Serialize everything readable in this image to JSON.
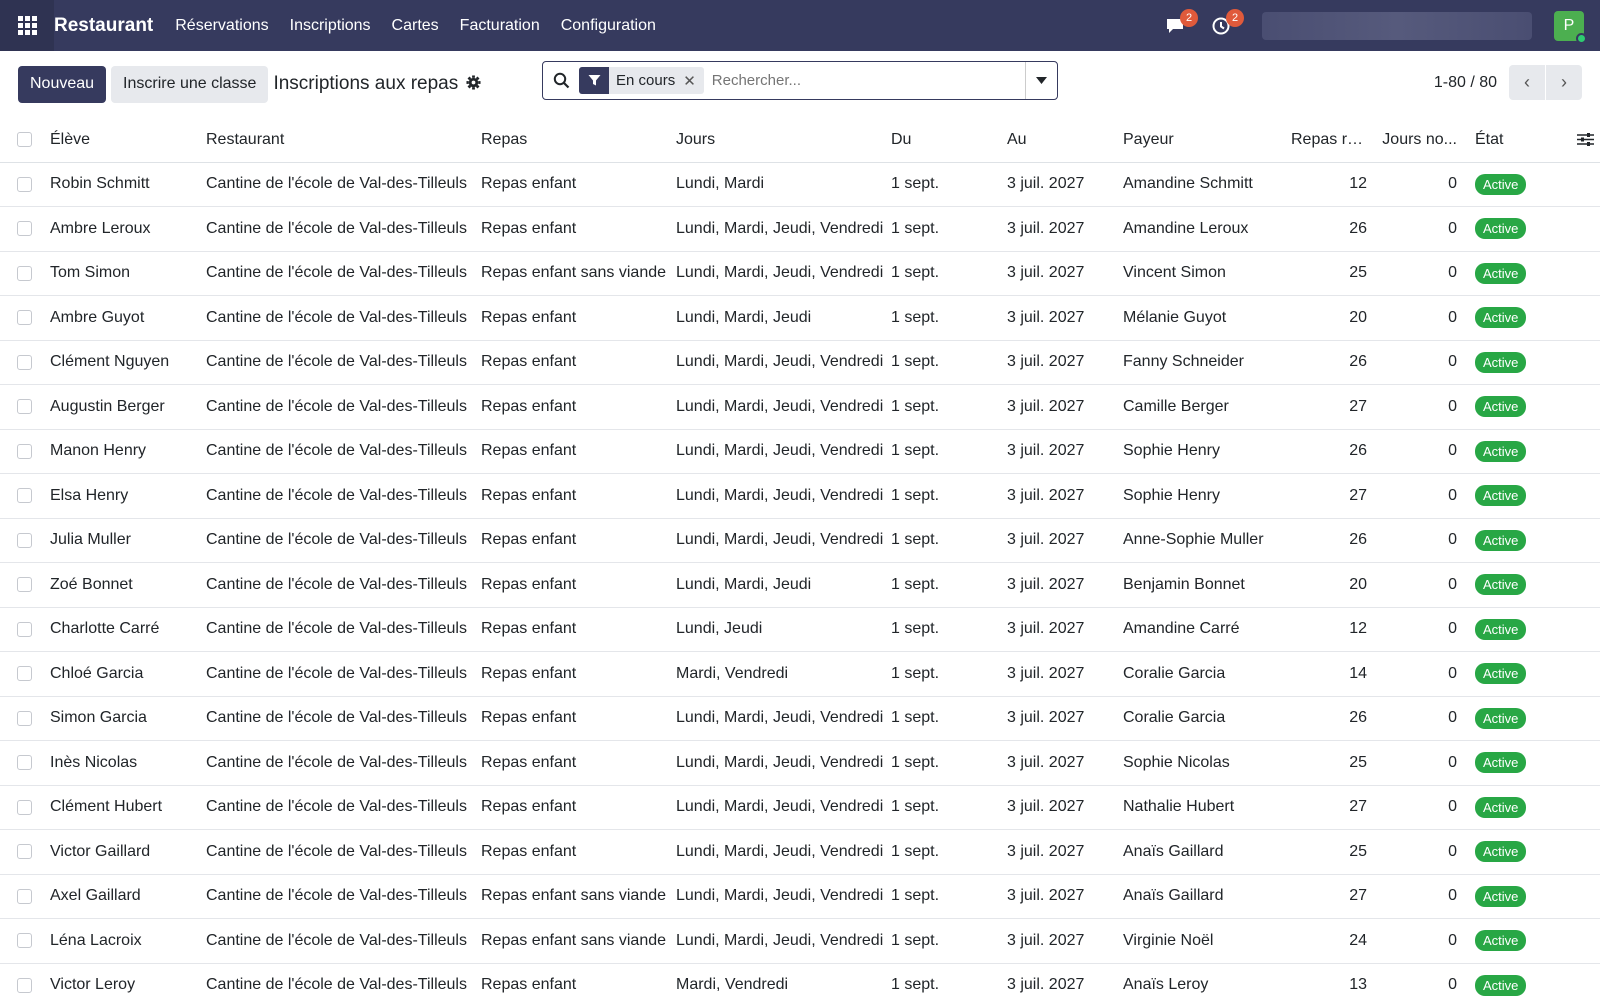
{
  "navbar": {
    "brand": "Restaurant",
    "menu": [
      "Réservations",
      "Inscriptions",
      "Cartes",
      "Facturation",
      "Configuration"
    ],
    "messages_count": "2",
    "activities_count": "2",
    "user_initial": "P"
  },
  "control": {
    "new_label": "Nouveau",
    "enroll_class_label": "Inscrire une classe",
    "title": "Inscriptions aux repas",
    "facet_label": "En cours",
    "search_placeholder": "Rechercher...",
    "pager": "1-80 / 80"
  },
  "table": {
    "columns": [
      "Élève",
      "Restaurant",
      "Repas",
      "Jours",
      "Du",
      "Au",
      "Payeur",
      "Repas ré...",
      "Jours no...",
      "État"
    ],
    "rows": [
      [
        "Robin Schmitt",
        "Cantine de l'école de Val-des-Tilleuls",
        "Repas enfant",
        "Lundi, Mardi",
        "1 sept.",
        "3 juil. 2027",
        "Amandine Schmitt",
        "12",
        "0",
        "Active"
      ],
      [
        "Ambre Leroux",
        "Cantine de l'école de Val-des-Tilleuls",
        "Repas enfant",
        "Lundi, Mardi, Jeudi, Vendredi",
        "1 sept.",
        "3 juil. 2027",
        "Amandine Leroux",
        "26",
        "0",
        "Active"
      ],
      [
        "Tom Simon",
        "Cantine de l'école de Val-des-Tilleuls",
        "Repas enfant sans viande",
        "Lundi, Mardi, Jeudi, Vendredi",
        "1 sept.",
        "3 juil. 2027",
        "Vincent Simon",
        "25",
        "0",
        "Active"
      ],
      [
        "Ambre Guyot",
        "Cantine de l'école de Val-des-Tilleuls",
        "Repas enfant",
        "Lundi, Mardi, Jeudi",
        "1 sept.",
        "3 juil. 2027",
        "Mélanie Guyot",
        "20",
        "0",
        "Active"
      ],
      [
        "Clément Nguyen",
        "Cantine de l'école de Val-des-Tilleuls",
        "Repas enfant",
        "Lundi, Mardi, Jeudi, Vendredi",
        "1 sept.",
        "3 juil. 2027",
        "Fanny Schneider",
        "26",
        "0",
        "Active"
      ],
      [
        "Augustin Berger",
        "Cantine de l'école de Val-des-Tilleuls",
        "Repas enfant",
        "Lundi, Mardi, Jeudi, Vendredi",
        "1 sept.",
        "3 juil. 2027",
        "Camille Berger",
        "27",
        "0",
        "Active"
      ],
      [
        "Manon Henry",
        "Cantine de l'école de Val-des-Tilleuls",
        "Repas enfant",
        "Lundi, Mardi, Jeudi, Vendredi",
        "1 sept.",
        "3 juil. 2027",
        "Sophie Henry",
        "26",
        "0",
        "Active"
      ],
      [
        "Elsa Henry",
        "Cantine de l'école de Val-des-Tilleuls",
        "Repas enfant",
        "Lundi, Mardi, Jeudi, Vendredi",
        "1 sept.",
        "3 juil. 2027",
        "Sophie Henry",
        "27",
        "0",
        "Active"
      ],
      [
        "Julia Muller",
        "Cantine de l'école de Val-des-Tilleuls",
        "Repas enfant",
        "Lundi, Mardi, Jeudi, Vendredi",
        "1 sept.",
        "3 juil. 2027",
        "Anne-Sophie Muller",
        "26",
        "0",
        "Active"
      ],
      [
        "Zoé Bonnet",
        "Cantine de l'école de Val-des-Tilleuls",
        "Repas enfant",
        "Lundi, Mardi, Jeudi",
        "1 sept.",
        "3 juil. 2027",
        "Benjamin Bonnet",
        "20",
        "0",
        "Active"
      ],
      [
        "Charlotte Carré",
        "Cantine de l'école de Val-des-Tilleuls",
        "Repas enfant",
        "Lundi, Jeudi",
        "1 sept.",
        "3 juil. 2027",
        "Amandine Carré",
        "12",
        "0",
        "Active"
      ],
      [
        "Chloé Garcia",
        "Cantine de l'école de Val-des-Tilleuls",
        "Repas enfant",
        "Mardi, Vendredi",
        "1 sept.",
        "3 juil. 2027",
        "Coralie Garcia",
        "14",
        "0",
        "Active"
      ],
      [
        "Simon Garcia",
        "Cantine de l'école de Val-des-Tilleuls",
        "Repas enfant",
        "Lundi, Mardi, Jeudi, Vendredi",
        "1 sept.",
        "3 juil. 2027",
        "Coralie Garcia",
        "26",
        "0",
        "Active"
      ],
      [
        "Inès Nicolas",
        "Cantine de l'école de Val-des-Tilleuls",
        "Repas enfant",
        "Lundi, Mardi, Jeudi, Vendredi",
        "1 sept.",
        "3 juil. 2027",
        "Sophie Nicolas",
        "25",
        "0",
        "Active"
      ],
      [
        "Clément Hubert",
        "Cantine de l'école de Val-des-Tilleuls",
        "Repas enfant",
        "Lundi, Mardi, Jeudi, Vendredi",
        "1 sept.",
        "3 juil. 2027",
        "Nathalie Hubert",
        "27",
        "0",
        "Active"
      ],
      [
        "Victor Gaillard",
        "Cantine de l'école de Val-des-Tilleuls",
        "Repas enfant",
        "Lundi, Mardi, Jeudi, Vendredi",
        "1 sept.",
        "3 juil. 2027",
        "Anaïs Gaillard",
        "25",
        "0",
        "Active"
      ],
      [
        "Axel Gaillard",
        "Cantine de l'école de Val-des-Tilleuls",
        "Repas enfant sans viande",
        "Lundi, Mardi, Jeudi, Vendredi",
        "1 sept.",
        "3 juil. 2027",
        "Anaïs Gaillard",
        "27",
        "0",
        "Active"
      ],
      [
        "Léna Lacroix",
        "Cantine de l'école de Val-des-Tilleuls",
        "Repas enfant sans viande",
        "Lundi, Mardi, Jeudi, Vendredi",
        "1 sept.",
        "3 juil. 2027",
        "Virginie Noël",
        "24",
        "0",
        "Active"
      ],
      [
        "Victor Leroy",
        "Cantine de l'école de Val-des-Tilleuls",
        "Repas enfant",
        "Mardi, Vendredi",
        "1 sept.",
        "3 juil. 2027",
        "Anaïs Leroy",
        "13",
        "0",
        "Active"
      ]
    ]
  },
  "colors": {
    "navbar": "#363a5e",
    "primary": "#363a5e",
    "badge_active": "#28a745",
    "notification": "#e05a3b"
  }
}
